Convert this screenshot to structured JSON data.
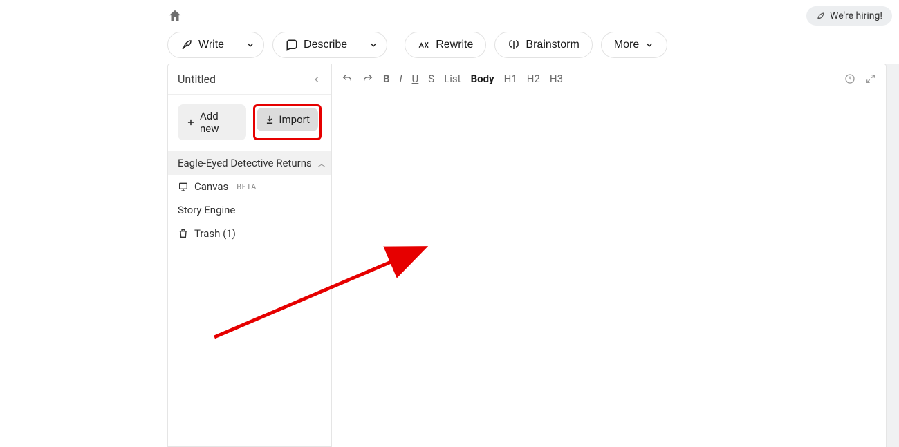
{
  "header": {
    "hiring_label": "We're hiring!"
  },
  "action_bar": {
    "write": "Write",
    "describe": "Describe",
    "rewrite": "Rewrite",
    "brainstorm": "Brainstorm",
    "more": "More"
  },
  "sidebar": {
    "title": "Untitled",
    "add_new_label": "Add new",
    "import_label": "Import",
    "active_item": "Eagle-Eyed Detective Returns",
    "canvas_label": "Canvas",
    "canvas_badge": "BETA",
    "story_engine_label": "Story Engine",
    "trash_label": "Trash (1)"
  },
  "editor_toolbar": {
    "list": "List",
    "body": "Body",
    "h1": "H1",
    "h2": "H2",
    "h3": "H3",
    "b": "B",
    "i": "I",
    "u": "U",
    "s": "S"
  },
  "annotation": {
    "highlight_color": "#e60000"
  }
}
